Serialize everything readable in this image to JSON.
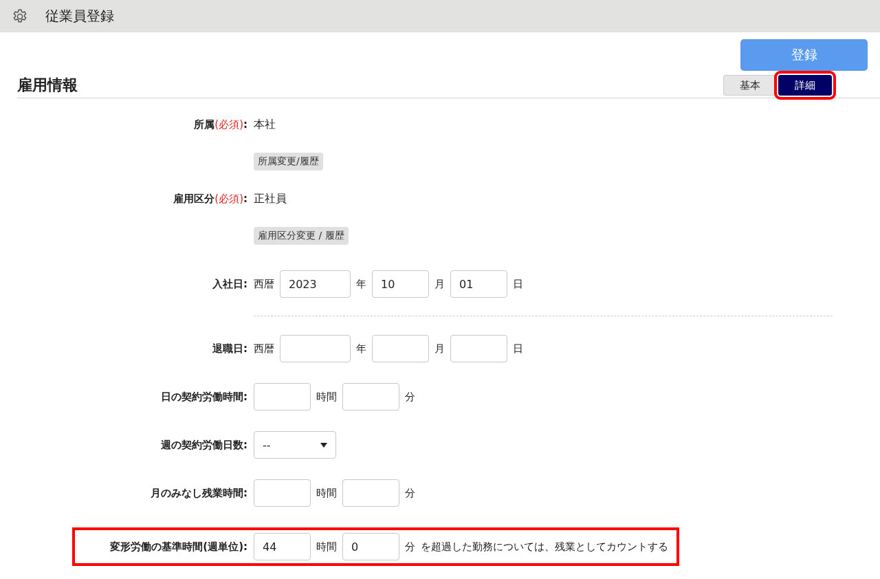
{
  "header": {
    "title": "従業員登録"
  },
  "register_button": "登録",
  "section": {
    "title": "雇用情報"
  },
  "tabs": [
    {
      "label": "基本",
      "selected": false,
      "highlighted": false
    },
    {
      "label": "詳細",
      "selected": true,
      "highlighted": true
    }
  ],
  "rows": [
    {
      "kind": "text",
      "label": "所属",
      "required": "(必須)",
      "colon": ":",
      "value": "本社",
      "highlighted": false
    },
    {
      "kind": "button",
      "button": "所属変更/履歴",
      "highlighted": false
    },
    {
      "kind": "text",
      "label": "雇用区分",
      "required": "(必須)",
      "colon": ":",
      "value": "正社員",
      "highlighted": false
    },
    {
      "kind": "button",
      "button": "雇用区分変更 / 履歴",
      "highlighted": false
    },
    {
      "kind": "fields",
      "label": "入社日:",
      "prefix": "西暦",
      "fields": [
        {
          "value": "2023",
          "unit": "年"
        },
        {
          "value": "10",
          "unit": "月"
        },
        {
          "value": "01",
          "unit": "日"
        }
      ],
      "highlighted": false
    },
    {
      "kind": "divider",
      "highlighted": false
    },
    {
      "kind": "fields",
      "label": "退職日:",
      "prefix": "西暦",
      "fields": [
        {
          "unit": "年"
        },
        {
          "unit": "月"
        },
        {
          "unit": "日"
        }
      ],
      "highlighted": false
    },
    {
      "kind": "fields",
      "label": "日の契約労働時間:",
      "fields": [
        {
          "unit": "時間"
        },
        {
          "unit": "分"
        }
      ],
      "highlighted": false
    },
    {
      "kind": "select",
      "label": "週の契約労働日数:",
      "value": "--",
      "highlighted": false
    },
    {
      "kind": "fields",
      "label": "月のみなし残業時間:",
      "fields": [
        {
          "unit": "時間"
        },
        {
          "unit": "分"
        }
      ],
      "highlighted": false
    },
    {
      "kind": "fields",
      "label": "変形労働の基準時間(週単位):",
      "fields": [
        {
          "value": "44",
          "unit": "時間"
        },
        {
          "value": "0",
          "unit": "分"
        }
      ],
      "note": "を超過した勤務については、残業としてカウントする",
      "highlighted": true
    }
  ]
}
